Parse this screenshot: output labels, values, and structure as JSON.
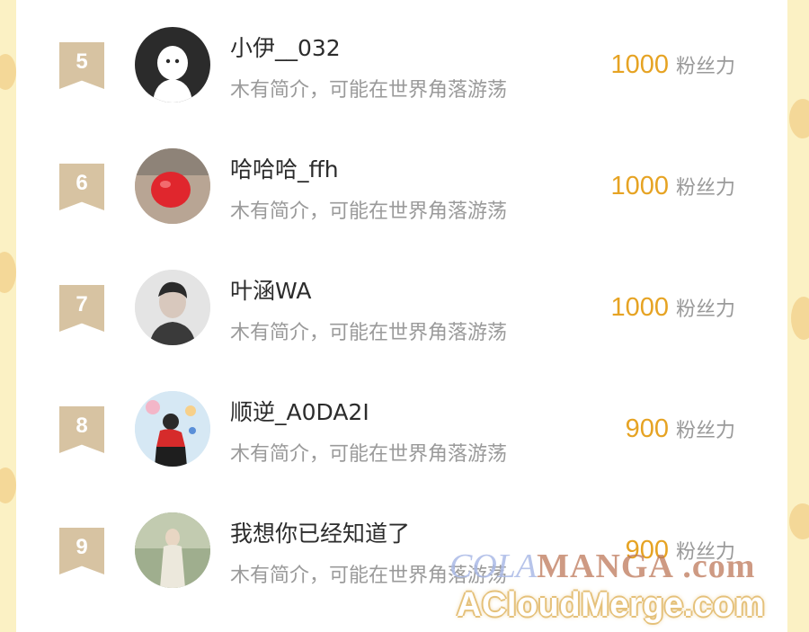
{
  "list": [
    {
      "rank": "5",
      "name": "小伊__032",
      "bio": "木有简介，可能在世界角落游荡",
      "fans_count": "1000",
      "fans_label": "粉丝力"
    },
    {
      "rank": "6",
      "name": "哈哈哈_ffh",
      "bio": "木有简介，可能在世界角落游荡",
      "fans_count": "1000",
      "fans_label": "粉丝力"
    },
    {
      "rank": "7",
      "name": "叶涵WA",
      "bio": "木有简介，可能在世界角落游荡",
      "fans_count": "1000",
      "fans_label": "粉丝力"
    },
    {
      "rank": "8",
      "name": "顺逆_A0DA2I",
      "bio": "木有简介，可能在世界角落游荡",
      "fans_count": "900",
      "fans_label": "粉丝力"
    },
    {
      "rank": "9",
      "name": "我想你已经知道了",
      "bio": "木有简介，可能在世界角落游荡",
      "fans_count": "900",
      "fans_label": "粉丝力"
    }
  ],
  "colors": {
    "fans_number": "#e6a323",
    "rank_badge": "#d7c3a2",
    "background": "#fbf1c4"
  },
  "watermark": {
    "line1_a": "COLA",
    "line1_b": "MANGA",
    ".com": ".com",
    "line1_c": ".com",
    "line2": "ACloudMerge.com"
  }
}
